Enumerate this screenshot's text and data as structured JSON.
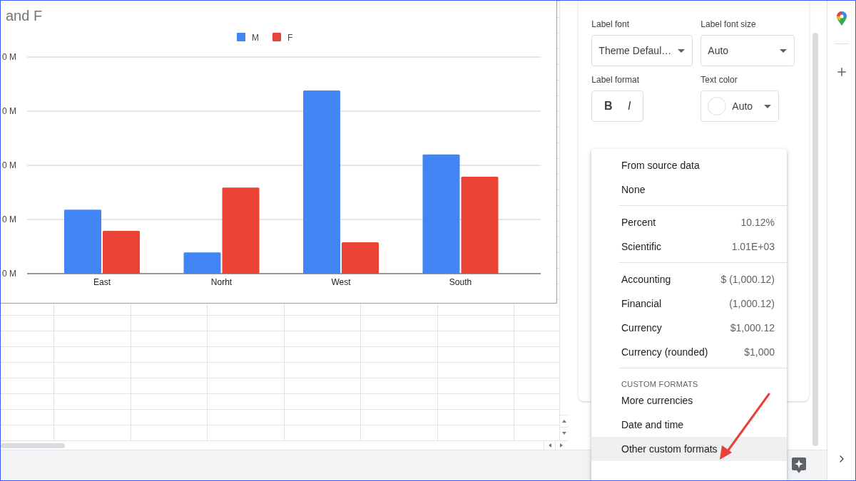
{
  "chart": {
    "title": "and F",
    "chart_data": {
      "type": "bar",
      "legend": "top",
      "grid": true,
      "categories": [
        "East",
        "Norht",
        "West",
        "South"
      ],
      "series": [
        {
          "name": "M",
          "color": "#4285f4",
          "values": [
            1.18,
            0.39,
            3.38,
            2.2
          ]
        },
        {
          "name": "F",
          "color": "#ea4335",
          "values": [
            0.79,
            1.59,
            0.58,
            1.79
          ]
        }
      ],
      "ylim": [
        0,
        4
      ],
      "yticks": [
        {
          "value": 0,
          "label": "0 M"
        },
        {
          "value": 1,
          "label": "0 M"
        },
        {
          "value": 2,
          "label": "0 M"
        },
        {
          "value": 3,
          "label": "0 M"
        },
        {
          "value": 4,
          "label": "0 M"
        }
      ]
    }
  },
  "panel": {
    "label_font": {
      "label": "Label font",
      "value": "Theme Defaul…"
    },
    "label_font_size": {
      "label": "Label font size",
      "value": "Auto"
    },
    "label_format": {
      "label": "Label format",
      "bold": "B",
      "italic": "I"
    },
    "text_color": {
      "label": "Text color",
      "value": "Auto"
    }
  },
  "menu": {
    "items": [
      {
        "kind": "option",
        "label": "From source data",
        "selected": false
      },
      {
        "kind": "option",
        "label": "None",
        "selected": false
      },
      {
        "kind": "divider"
      },
      {
        "kind": "option",
        "label": "Percent",
        "example": "10.12%",
        "selected": false
      },
      {
        "kind": "option",
        "label": "Scientific",
        "example": "1.01E+03",
        "selected": false
      },
      {
        "kind": "divider"
      },
      {
        "kind": "option",
        "label": "Accounting",
        "example": "$ (1,000.12)",
        "selected": false
      },
      {
        "kind": "option",
        "label": "Financial",
        "example": "(1,000.12)",
        "selected": false
      },
      {
        "kind": "option",
        "label": "Currency",
        "example": "$1,000.12",
        "selected": false
      },
      {
        "kind": "option",
        "label": "Currency (rounded)",
        "example": "$1,000",
        "selected": false
      },
      {
        "kind": "divider"
      },
      {
        "kind": "header",
        "label": "CUSTOM FORMATS"
      },
      {
        "kind": "option",
        "label": "More currencies",
        "selected": false
      },
      {
        "kind": "option",
        "label": "Date and time",
        "selected": false
      },
      {
        "kind": "option",
        "label": "Other custom formats",
        "selected": true
      }
    ]
  }
}
